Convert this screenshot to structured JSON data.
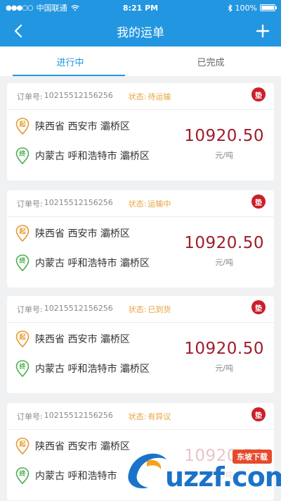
{
  "status_bar": {
    "signal": "●●●○○",
    "carrier": "中国联通",
    "time": "8:21 PM",
    "battery": "100%",
    "battery_level": 1.0
  },
  "nav": {
    "title": "我的运单",
    "back_icon": "chevron-left-icon",
    "add_icon": "plus-icon"
  },
  "tabs": [
    {
      "label": "进行中",
      "active": true
    },
    {
      "label": "已完成",
      "active": false
    }
  ],
  "orders": [
    {
      "order_label": "订单号:",
      "order_no": "10215512156256",
      "status_label": "状态:",
      "status": "待运输",
      "badge": "垫",
      "from_marker": "起",
      "from": "陕西省 西安市 灞桥区",
      "to_marker": "终",
      "to": "内蒙古 呼和浩特市 灞桥区",
      "price": "10920.50",
      "unit": "元/吨"
    },
    {
      "order_label": "订单号:",
      "order_no": "10215512156256",
      "status_label": "状态:",
      "status": "运输中",
      "badge": "垫",
      "from_marker": "起",
      "from": "陕西省 西安市 灞桥区",
      "to_marker": "终",
      "to": "内蒙古 呼和浩特市 灞桥区",
      "price": "10920.50",
      "unit": "元/吨"
    },
    {
      "order_label": "订单号:",
      "order_no": "10215512156256",
      "status_label": "状态:",
      "status": "已到货",
      "badge": "垫",
      "from_marker": "起",
      "from": "陕西省 西安市 灞桥区",
      "to_marker": "终",
      "to": "内蒙古 呼和浩特市 灞桥区",
      "price": "10920.50",
      "unit": "元/吨"
    },
    {
      "order_label": "订单号:",
      "order_no": "10215512156256",
      "status_label": "状态:",
      "status": "有异议",
      "badge": "垫",
      "from_marker": "起",
      "from": "陕西省 西安市 灞桥区",
      "to_marker": "终",
      "to": "内蒙古 呼和浩特市",
      "price": "10920.50",
      "unit": "元/吨"
    }
  ],
  "watermark": {
    "text": "uzzf.com",
    "badge": "东坡下载"
  },
  "colors": {
    "primary": "#2296e0",
    "status": "#e8a33c",
    "price": "#9d1d2a",
    "badge": "#c9202a"
  }
}
